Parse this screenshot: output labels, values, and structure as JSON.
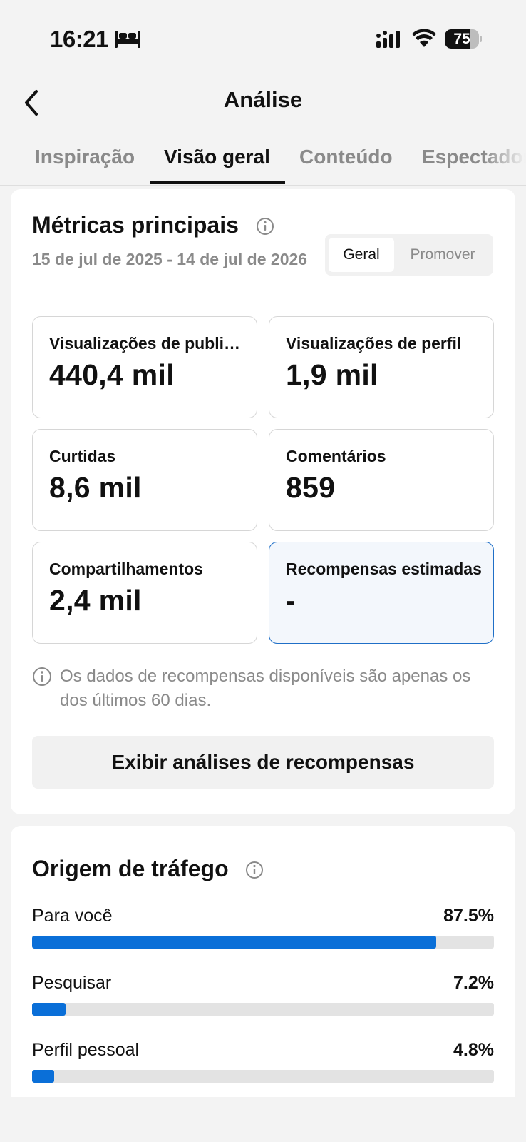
{
  "status_bar": {
    "time": "16:21",
    "battery_level": "75",
    "icons": [
      "bed-icon",
      "cellular-signal-icon",
      "wifi-icon",
      "battery-icon"
    ]
  },
  "header": {
    "title": "Análise",
    "back_icon": "chevron-left-icon"
  },
  "tabs": [
    {
      "label": "Inspiração",
      "active": false
    },
    {
      "label": "Visão geral",
      "active": true
    },
    {
      "label": "Conteúdo",
      "active": false
    },
    {
      "label": "Espectadores",
      "active": false
    }
  ],
  "metrics_section": {
    "title": "Métricas principais",
    "date_range": "15 de jul de 2025 - 14 de jul de 2026",
    "toggle": {
      "options": [
        "Geral",
        "Promover"
      ],
      "selected": "Geral"
    },
    "cards": [
      {
        "label": "Visualizações de publicação",
        "value": "440,4 mil"
      },
      {
        "label": "Visualizações de perfil",
        "value": "1,9 mil"
      },
      {
        "label": "Curtidas",
        "value": "8,6 mil"
      },
      {
        "label": "Comentários",
        "value": "859"
      },
      {
        "label": "Compartilhamentos",
        "value": "2,4 mil"
      },
      {
        "label": "Recompensas estimadas",
        "value": "-",
        "highlighted": true
      }
    ],
    "note": "Os dados de recompensas disponíveis são apenas os dos últimos 60 dias.",
    "button_label": "Exibir análises de recompensas"
  },
  "traffic_section": {
    "title": "Origem de tráfego",
    "sources": [
      {
        "label": "Para você",
        "value": "87.5%",
        "fraction": 0.875
      },
      {
        "label": "Pesquisar",
        "value": "7.2%",
        "fraction": 0.072
      },
      {
        "label": "Perfil pessoal",
        "value": "4.8%",
        "fraction": 0.048
      }
    ]
  },
  "colors": {
    "accent_blue": "#0a6fd8",
    "highlight_border": "#1f6fc7",
    "background": "#f3f3f3",
    "muted_text": "#8a8a8a"
  }
}
